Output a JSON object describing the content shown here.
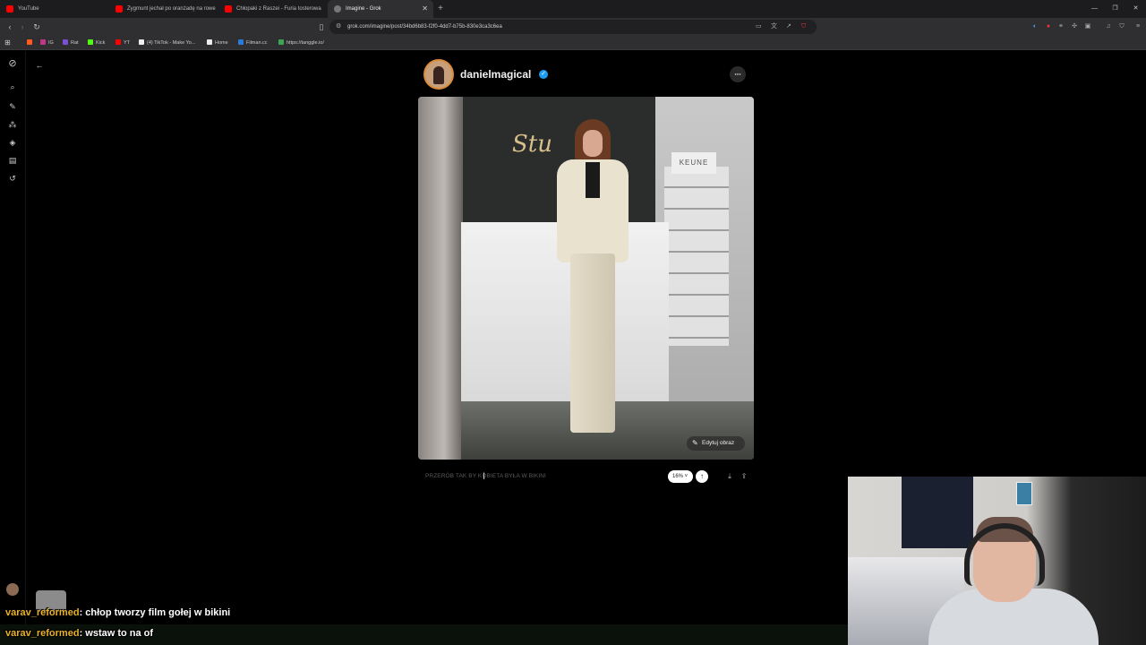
{
  "browser": {
    "tabs": [
      {
        "label": "YouTube",
        "color": "#ff0000",
        "active": false
      },
      {
        "label": "Zygmunt jechał po oranżadę na rowe",
        "color": "#ff0000",
        "active": false
      },
      {
        "label": "Chłopaki z Raszei - Furia tosterowa",
        "color": "#ff0000",
        "active": false
      },
      {
        "label": "Imagine - Grok",
        "color": "#cccccc",
        "active": true
      }
    ],
    "url": "grok.com/imagine/post/34bd6b83-f2f0-4dd7-b75b-830e3ca3c6ea",
    "bookmarks": [
      {
        "label": "IG",
        "color": "#c13584"
      },
      {
        "label": "Rat",
        "color": "#7a4fd0"
      },
      {
        "label": "Kick",
        "color": "#53fc18"
      },
      {
        "label": "YT",
        "color": "#ff0000"
      },
      {
        "label": "(4) TikTok - Make Yo...",
        "color": "#eeeeee"
      },
      {
        "label": "Home",
        "color": "#eeeeee"
      },
      {
        "label": "Filman.cc",
        "color": "#2b7bd6"
      },
      {
        "label": "https://tanggle.io/",
        "color": "#3aa655"
      }
    ]
  },
  "post": {
    "username": "danielmagical",
    "image_sign_text": "Stu",
    "image_brand_text": "KEUNE",
    "edit_label": "Edytuj obraz",
    "prompt_placeholder": "PRZERÓB TAK BY KOBIETA BYŁA W BIKINI",
    "percent_label": "16%",
    "accent_color": "#1d9bf0"
  },
  "chat": {
    "messages": [
      {
        "user": "varav_reformed",
        "text": ": chłop tworzy film gołej w bikini"
      },
      {
        "user": "varav_reformed",
        "text": ": wstaw to na of"
      }
    ]
  }
}
